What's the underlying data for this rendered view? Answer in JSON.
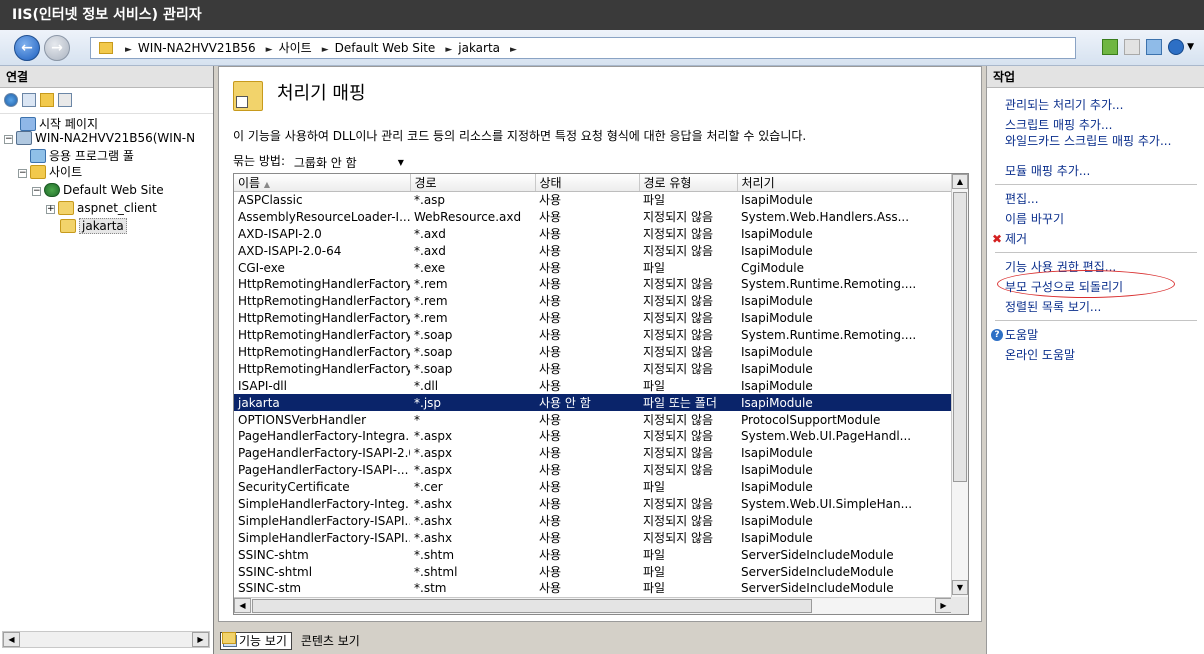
{
  "window": {
    "title": "IIS(인터넷 정보 서비스) 관리자"
  },
  "address": {
    "crumbs": [
      "WIN-NA2HVV21B56",
      "사이트",
      "Default Web Site",
      "jakarta"
    ]
  },
  "connections": {
    "title": "연결",
    "tree": [
      {
        "label": "시작 페이지"
      },
      {
        "label": "WIN-NA2HVV21B56(WIN-N"
      },
      {
        "label": "응용 프로그램 풀"
      },
      {
        "label": "사이트"
      },
      {
        "label": "Default Web Site"
      },
      {
        "label": "aspnet_client"
      },
      {
        "label": "jakarta"
      }
    ]
  },
  "feature": {
    "title": "처리기 매핑",
    "description": "이 기능을 사용하여 DLL이나 관리 코드 등의 리소스를 지정하면 특정 요청 형식에 대한 응답을 처리할 수 있습니다.",
    "group_by_label": "묶는 방법:",
    "group_by_value": "그룹화 안 함",
    "columns": [
      "이름",
      "경로",
      "상태",
      "경로 유형",
      "처리기"
    ],
    "rows": [
      [
        "ASPClassic",
        "*.asp",
        "사용",
        "파일",
        "IsapiModule"
      ],
      [
        "AssemblyResourceLoader-I...",
        "WebResource.axd",
        "사용",
        "지정되지 않음",
        "System.Web.Handlers.Ass..."
      ],
      [
        "AXD-ISAPI-2.0",
        "*.axd",
        "사용",
        "지정되지 않음",
        "IsapiModule"
      ],
      [
        "AXD-ISAPI-2.0-64",
        "*.axd",
        "사용",
        "지정되지 않음",
        "IsapiModule"
      ],
      [
        "CGI-exe",
        "*.exe",
        "사용",
        "파일",
        "CgiModule"
      ],
      [
        "HttpRemotingHandlerFactory...",
        "*.rem",
        "사용",
        "지정되지 않음",
        "System.Runtime.Remoting...."
      ],
      [
        "HttpRemotingHandlerFactory...",
        "*.rem",
        "사용",
        "지정되지 않음",
        "IsapiModule"
      ],
      [
        "HttpRemotingHandlerFactory...",
        "*.rem",
        "사용",
        "지정되지 않음",
        "IsapiModule"
      ],
      [
        "HttpRemotingHandlerFactory...",
        "*.soap",
        "사용",
        "지정되지 않음",
        "System.Runtime.Remoting...."
      ],
      [
        "HttpRemotingHandlerFactory...",
        "*.soap",
        "사용",
        "지정되지 않음",
        "IsapiModule"
      ],
      [
        "HttpRemotingHandlerFactory...",
        "*.soap",
        "사용",
        "지정되지 않음",
        "IsapiModule"
      ],
      [
        "ISAPI-dll",
        "*.dll",
        "사용",
        "파일",
        "IsapiModule"
      ],
      [
        "jakarta",
        "*.jsp",
        "사용 안 함",
        "파일 또는 폴더",
        "IsapiModule"
      ],
      [
        "OPTIONSVerbHandler",
        "*",
        "사용",
        "지정되지 않음",
        "ProtocolSupportModule"
      ],
      [
        "PageHandlerFactory-Integra...",
        "*.aspx",
        "사용",
        "지정되지 않음",
        "System.Web.UI.PageHandl..."
      ],
      [
        "PageHandlerFactory-ISAPI-2.0",
        "*.aspx",
        "사용",
        "지정되지 않음",
        "IsapiModule"
      ],
      [
        "PageHandlerFactory-ISAPI-...",
        "*.aspx",
        "사용",
        "지정되지 않음",
        "IsapiModule"
      ],
      [
        "SecurityCertificate",
        "*.cer",
        "사용",
        "파일",
        "IsapiModule"
      ],
      [
        "SimpleHandlerFactory-Integ...",
        "*.ashx",
        "사용",
        "지정되지 않음",
        "System.Web.UI.SimpleHan..."
      ],
      [
        "SimpleHandlerFactory-ISAPI...",
        "*.ashx",
        "사용",
        "지정되지 않음",
        "IsapiModule"
      ],
      [
        "SimpleHandlerFactory-ISAPI...",
        "*.ashx",
        "사용",
        "지정되지 않음",
        "IsapiModule"
      ],
      [
        "SSINC-shtm",
        "*.shtm",
        "사용",
        "파일",
        "ServerSideIncludeModule"
      ],
      [
        "SSINC-shtml",
        "*.shtml",
        "사용",
        "파일",
        "ServerSideIncludeModule"
      ],
      [
        "SSINC-stm",
        "*.stm",
        "사용",
        "파일",
        "ServerSideIncludeModule"
      ]
    ],
    "selected_row": 12,
    "view_tabs": [
      "기능 보기",
      "콘텐츠 보기"
    ]
  },
  "actions": {
    "title": "작업",
    "items": [
      "관리되는 처리기 추가...",
      "스크립트 매핑 추가...",
      "와일드카드 스크립트 매핑 추가...",
      "모듈 매핑 추가...",
      "편집...",
      "이름 바꾸기",
      "제거",
      "기능 사용 권한 편집...",
      "부모 구성으로 되돌리기",
      "정렬된 목록 보기...",
      "도움말",
      "온라인 도움말"
    ]
  }
}
